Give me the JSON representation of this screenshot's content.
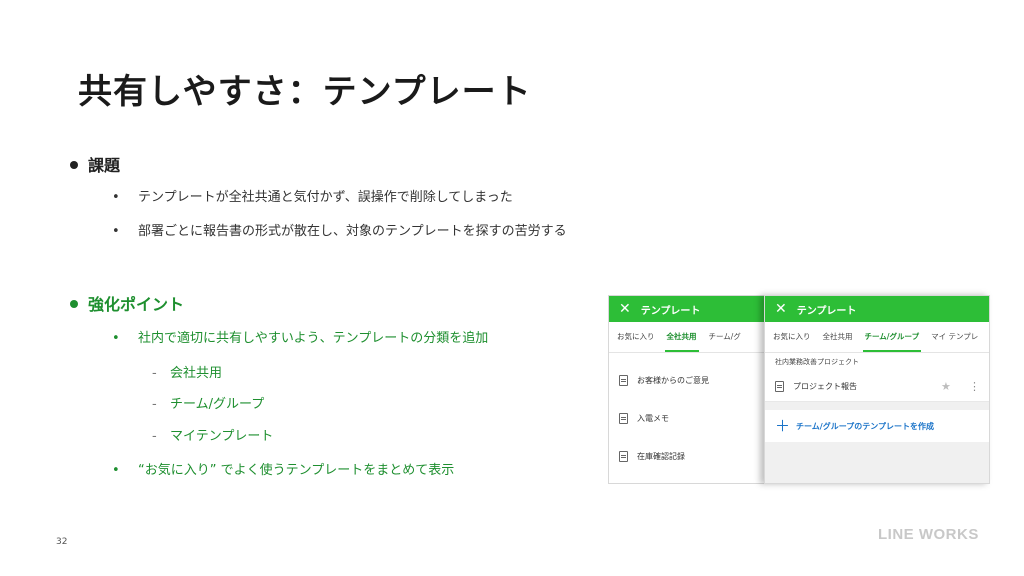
{
  "slide": {
    "title": "共有しやすさ：テンプレート",
    "page_number": "32",
    "logo": "LINE WORKS"
  },
  "issues": {
    "heading": "課題",
    "bullets": [
      "テンプレートが全社共通と気付かず、誤操作で削除してしまった",
      "部署ごとに報告書の形式が散在し、対象のテンプレートを探すの苦労する"
    ]
  },
  "improvements": {
    "heading": "強化ポイント",
    "bullet1": "社内で適切に共有しやすいよう、テンプレートの分類を追加",
    "sub_items": [
      "会社共用",
      "チーム/グループ",
      "マイテンプレート"
    ],
    "bullet2": "“お気に入り” でよく使うテンプレートをまとめて表示"
  },
  "screen_a": {
    "header_title": "テンプレート",
    "tabs": [
      "お気に入り",
      "全社共用",
      "チーム/グ"
    ],
    "active_tab": "全社共用",
    "items": [
      "お客様からのご意見",
      "入電メモ",
      "在庫確認記録"
    ]
  },
  "screen_b": {
    "header_title": "テンプレート",
    "tabs": [
      "お気に入り",
      "全社共用",
      "チーム/グループ",
      "マイ テンプレ"
    ],
    "active_tab": "チーム/グループ",
    "group_name": "社内業務改善プロジェクト",
    "item": "プロジェクト報告",
    "create_label": "チーム/グループのテンプレートを作成"
  },
  "colors": {
    "accent_green": "#2dbe37",
    "text_green": "#1e8f2f",
    "link_blue": "#1a73c8"
  }
}
